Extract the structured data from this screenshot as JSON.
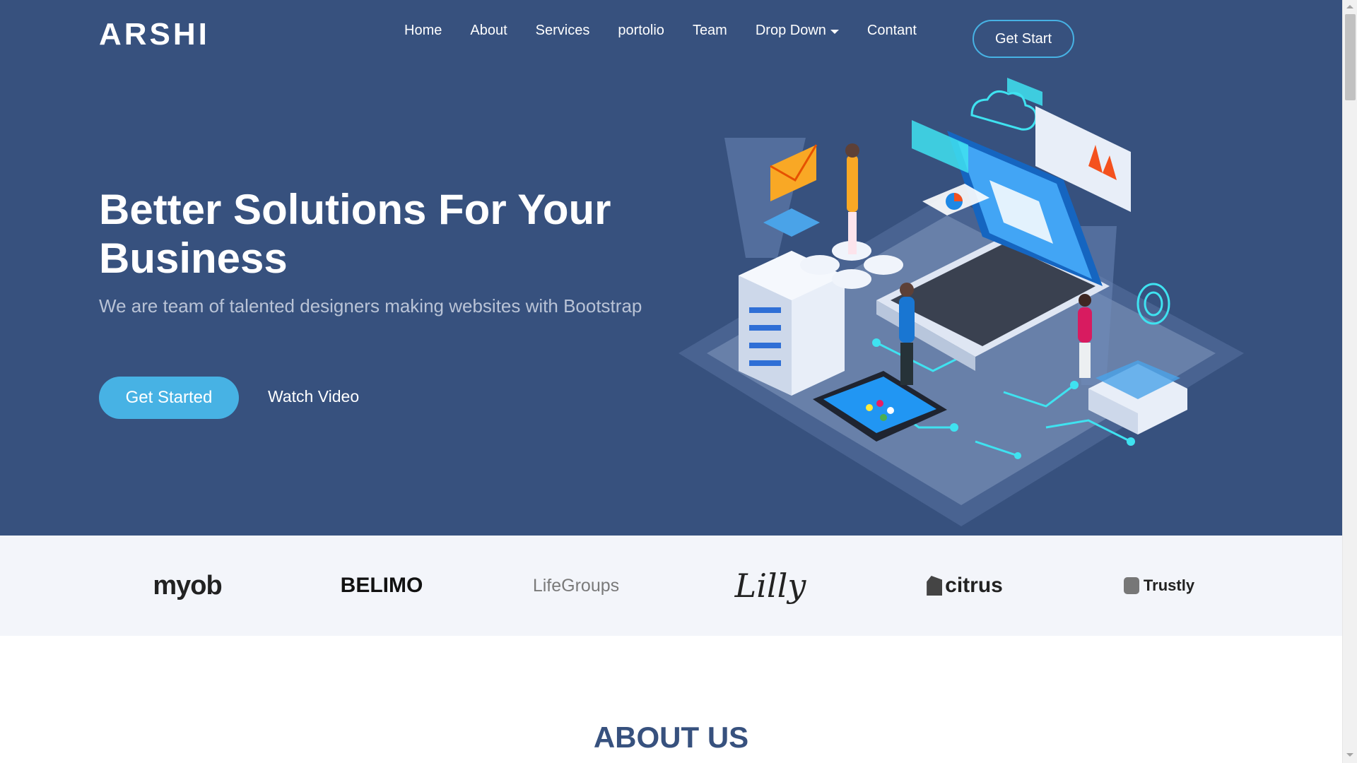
{
  "header": {
    "logo": "ARSHI",
    "nav": [
      {
        "label": "Home"
      },
      {
        "label": "About"
      },
      {
        "label": "Services"
      },
      {
        "label": "portolio"
      },
      {
        "label": "Team"
      },
      {
        "label": "Drop Down",
        "has_caret": true
      },
      {
        "label": "Contant"
      }
    ],
    "cta": "Get Start"
  },
  "hero": {
    "title": "Better Solutions For Your Business",
    "subtitle": "We are team of talented designers making websites with Bootstrap",
    "primary_button": "Get Started",
    "secondary_button": "Watch Video",
    "illustration_icon": "isometric-tech-illustration"
  },
  "clients": [
    {
      "name": "myob",
      "icon": "myob-logo"
    },
    {
      "name": "BELIMO",
      "icon": "belimo-logo"
    },
    {
      "name": "LifeGroups",
      "icon": "lifegroups-logo"
    },
    {
      "name": "Lilly",
      "icon": "lilly-logo"
    },
    {
      "name": "citrus",
      "icon": "citrus-logo"
    },
    {
      "name": "Trustly",
      "icon": "trustly-logo"
    }
  ],
  "about": {
    "title": "ABOUT US"
  },
  "colors": {
    "hero_bg": "#37517e",
    "accent": "#47b2e4",
    "clients_bg": "#f3f5fa"
  }
}
